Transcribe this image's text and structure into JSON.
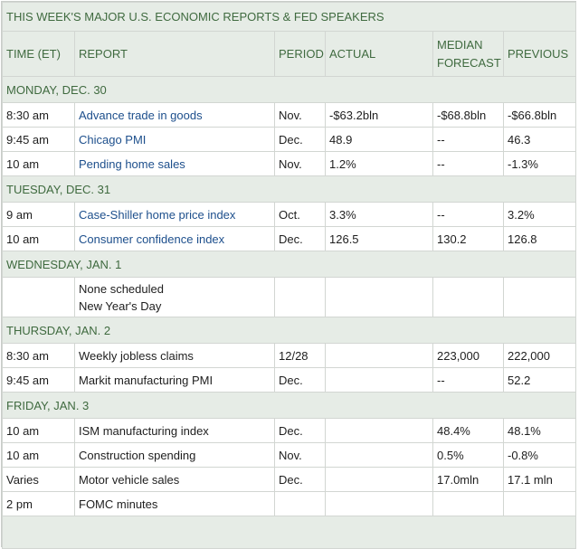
{
  "title": "THIS WEEK'S MAJOR U.S. ECONOMIC REPORTS & FED SPEAKERS",
  "headers": {
    "time": "TIME (ET)",
    "report": "REPORT",
    "period": "PERIOD",
    "actual": "ACTUAL",
    "median_line1": "MEDIAN",
    "median_line2": "FORECAST",
    "previous": "PREVIOUS"
  },
  "days": [
    {
      "label": "MONDAY, DEC. 30",
      "rows": [
        {
          "time": "8:30 am",
          "report": "Advance trade in goods",
          "period": "Nov.",
          "actual": "-$63.2bln",
          "median": "-$68.8bln",
          "previous": "-$66.8bln"
        },
        {
          "time": "9:45 am",
          "report": "Chicago PMI",
          "period": "Dec.",
          "actual": "48.9",
          "median": "--",
          "previous": "46.3"
        },
        {
          "time": "10 am",
          "report": "Pending home sales",
          "period": "Nov.",
          "actual": "1.2%",
          "median": "--",
          "previous": "-1.3%"
        }
      ]
    },
    {
      "label": "TUESDAY, DEC. 31",
      "rows": [
        {
          "time": "9 am",
          "report": "Case-Shiller home price index",
          "period": "Oct.",
          "actual": "3.3%",
          "median": "--",
          "previous": "3.2%"
        },
        {
          "time": "10 am",
          "report": "Consumer confidence index",
          "period": "Dec.",
          "actual": "126.5",
          "median": "130.2",
          "previous": "126.8"
        }
      ]
    },
    {
      "label": "WEDNESDAY, JAN. 1",
      "rows": [
        {
          "time": "",
          "report_line1": "None scheduled",
          "report_line2": "New Year's Day",
          "period": "",
          "actual": "",
          "median": "",
          "previous": ""
        }
      ]
    },
    {
      "label": "THURSDAY, JAN. 2",
      "rows": [
        {
          "time": "8:30 am",
          "report": "Weekly jobless claims",
          "period": "12/28",
          "actual": "",
          "median": "223,000",
          "previous": "222,000"
        },
        {
          "time": "9:45 am",
          "report": "Markit manufacturing PMI",
          "period": "Dec.",
          "actual": "",
          "median": "--",
          "previous": "52.2"
        }
      ]
    },
    {
      "label": "FRIDAY, JAN. 3",
      "rows": [
        {
          "time": "10 am",
          "report": "ISM manufacturing index",
          "period": "Dec.",
          "actual": "",
          "median": "48.4%",
          "previous": "48.1%"
        },
        {
          "time": "10 am",
          "report": "Construction spending",
          "period": "Nov.",
          "actual": "",
          "median": "0.5%",
          "previous": "-0.8%"
        },
        {
          "time": "Varies",
          "report": "Motor vehicle sales",
          "period": "Dec.",
          "actual": "",
          "median": "17.0mln",
          "previous": "17.1 mln"
        },
        {
          "time": "2 pm",
          "report": "FOMC minutes",
          "period": "",
          "actual": "",
          "median": "",
          "previous": ""
        }
      ]
    }
  ]
}
